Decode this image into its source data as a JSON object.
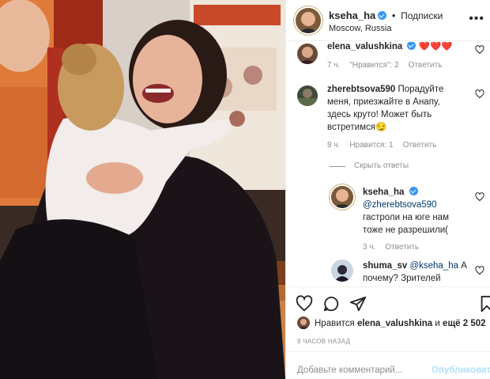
{
  "post": {
    "username": "kseha_ha",
    "dot": "•",
    "follow_label": "Подписки",
    "location": "Moscow, Russia",
    "more_label": "•••"
  },
  "comments": [
    {
      "username": "elena_valushkina",
      "text": "❤️❤️❤️",
      "time": "7 ч.",
      "likes": "\"Нравится\": 2",
      "reply_label": "Ответить"
    },
    {
      "username": "zherebtsova590",
      "text_lines": [
        "Порадуйте",
        "меня, приезжайте в Анапу,",
        "здесь круто! Может быть",
        "встретимся😏"
      ],
      "time": "8 ч.",
      "likes": "Нравится: 1",
      "reply_label": "Ответить",
      "hide_replies": "Скрыть ответы"
    }
  ],
  "reply": {
    "username": "kseha_ha",
    "mention": "@zherebtsova590",
    "text_lines": [
      "гастроли на юге нам",
      "тоже не разрешили("
    ],
    "time": "3 ч.",
    "reply_label": "Ответить"
  },
  "reply2": {
    "username": "shuma_sv",
    "mention": "@kseha_ha",
    "text_a": "А",
    "text_b": "почему? Зрителей"
  },
  "likes": {
    "prefix": "Нравится",
    "user": "elena_valushkina",
    "middle": "и",
    "count": "ещё 2 502"
  },
  "time_ago": "9 ЧАСОВ НАЗАД",
  "add_comment": {
    "placeholder": "Добавьте комментарий...",
    "post_label": "Опубликовать"
  },
  "colors": {
    "link": "#00376b",
    "muted": "#8e8e8e",
    "verified": "#3897f0",
    "post_button": "#b2dffc"
  },
  "icons": [
    "heart-icon",
    "comment-icon",
    "share-icon",
    "bookmark-icon",
    "verified-icon",
    "more-icon"
  ]
}
